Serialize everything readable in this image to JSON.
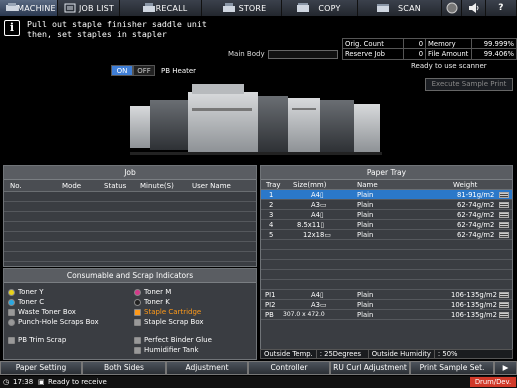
{
  "tabs": [
    {
      "label": "MACHINE",
      "icon": "machine-icon",
      "active": true
    },
    {
      "label": "JOB LIST",
      "icon": "job-list-icon",
      "active": false
    },
    {
      "label": "RECALL",
      "icon": "recall-icon",
      "active": false
    },
    {
      "label": "STORE",
      "icon": "store-icon",
      "active": false
    },
    {
      "label": "COPY",
      "icon": "copy-icon",
      "active": false
    },
    {
      "label": "SCAN",
      "icon": "scan-icon",
      "active": false
    }
  ],
  "message": {
    "line1": "Pull out staple finisher saddle unit",
    "line2": "then, set staples in stapler"
  },
  "main_body_label": "Main Body",
  "status": {
    "orig_count_label": "Orig. Count",
    "orig_count_value": "0",
    "memory_label": "Memory",
    "memory_value": "99.999%",
    "reserve_job_label": "Reserve Job",
    "reserve_job_value": "0",
    "file_amount_label": "File Amount",
    "file_amount_value": "99.406%"
  },
  "scan_status": "Ready to use scanner",
  "execute_sample_print": "Execute Sample Print",
  "pb_heater": {
    "on_label": "ON",
    "off_label": "OFF",
    "label": "PB Heater"
  },
  "job": {
    "title": "Job",
    "columns": [
      "No.",
      "Mode",
      "Status",
      "Minute(S)",
      "User Name"
    ]
  },
  "consumables": {
    "title": "Consumable and Scrap Indicators",
    "items": [
      {
        "label": "Toner Y",
        "color": "#e8d21a"
      },
      {
        "label": "Toner M",
        "color": "#d43a8a"
      },
      {
        "label": "Toner C",
        "color": "#2aa7e0"
      },
      {
        "label": "Toner K",
        "color": "#222222"
      },
      {
        "label": "Waste Toner Box",
        "color": "#999999"
      },
      {
        "label": "Staple Cartridge",
        "color": "#ff9a1a"
      },
      {
        "label": "Punch-Hole Scraps Box",
        "color": "#999999"
      },
      {
        "label": "Staple Scrap Box",
        "color": "#999999"
      },
      {
        "label": "PB Trim Scrap",
        "color": "#999999"
      },
      {
        "label": "Perfect Binder Glue",
        "color": "#999999"
      },
      {
        "label": "Humidifier Tank",
        "color": "#999999"
      }
    ]
  },
  "paper_tray": {
    "title": "Paper Tray",
    "columns": [
      "Tray",
      "Size(mm)",
      "Name",
      "Weight"
    ],
    "rows": [
      {
        "tray": "1",
        "size": "A4▯",
        "name": "Plain",
        "weight": "81-91g/m2",
        "selected": true
      },
      {
        "tray": "2",
        "size": "A3▭",
        "name": "Plain",
        "weight": "62-74g/m2",
        "selected": false
      },
      {
        "tray": "3",
        "size": "A4▯",
        "name": "Plain",
        "weight": "62-74g/m2",
        "selected": false
      },
      {
        "tray": "4",
        "size": "8.5x11▯",
        "name": "Plain",
        "weight": "62-74g/m2",
        "selected": false
      },
      {
        "tray": "5",
        "size": "12x18▭",
        "name": "Plain",
        "weight": "62-74g/m2",
        "selected": false
      }
    ],
    "bottom_rows": [
      {
        "tray": "PI1",
        "size": "A4▯",
        "name": "Plain",
        "weight": "106-135g/m2"
      },
      {
        "tray": "PI2",
        "size": "A3▭",
        "name": "Plain",
        "weight": "106-135g/m2"
      },
      {
        "tray": "PB",
        "size": "307.0 x 472.0",
        "name": "Plain",
        "weight": "106-135g/m2"
      }
    ],
    "outside_temp_label": "Outside Temp.",
    "outside_temp_value": ": 25Degrees",
    "outside_humidity_label": "Outside Humidity",
    "outside_humidity_value": ": 50%"
  },
  "bottom_buttons": [
    "Paper Setting",
    "Both Sides",
    "Adjustment",
    "Controller",
    "RU Curl Adjustment",
    "Print Sample Set."
  ],
  "status_bar": {
    "time": "17:38",
    "text": "Ready to receive",
    "drum": "Drum/Dev."
  }
}
